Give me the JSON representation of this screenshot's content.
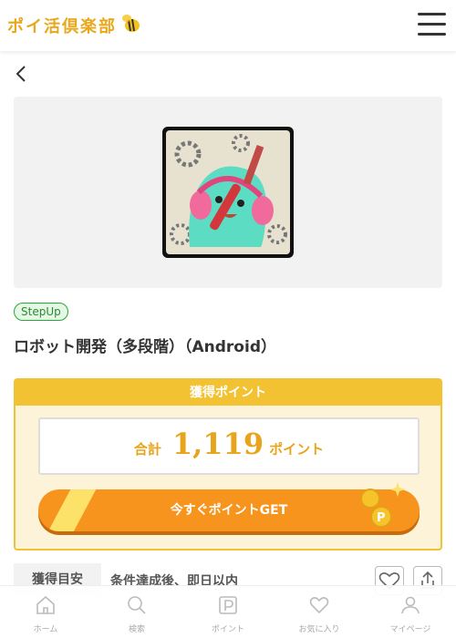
{
  "header": {
    "logo_text": "ポイ活倶楽部"
  },
  "offer": {
    "tag": "StepUp",
    "title": "ロボット開発（多段階）（Android）"
  },
  "points": {
    "heading": "獲得ポイント",
    "total_label": "合計",
    "total_value": "1,119",
    "total_unit": "ポイント",
    "cta_label": "今すぐポイントGET"
  },
  "estimate": {
    "label": "獲得目安",
    "value": "条件達成後、即日以内"
  },
  "tabbar": {
    "items": [
      {
        "label": "ホーム",
        "icon": "home-icon"
      },
      {
        "label": "検索",
        "icon": "search-icon"
      },
      {
        "label": "ポイント",
        "icon": "point-icon"
      },
      {
        "label": "お気に入り",
        "icon": "heart-icon"
      },
      {
        "label": "マイページ",
        "icon": "user-icon"
      }
    ]
  },
  "colors": {
    "accent": "#f2c233",
    "cta": "#f7941d",
    "tag_green": "#2aa83a",
    "point_text": "#e8a51c"
  }
}
